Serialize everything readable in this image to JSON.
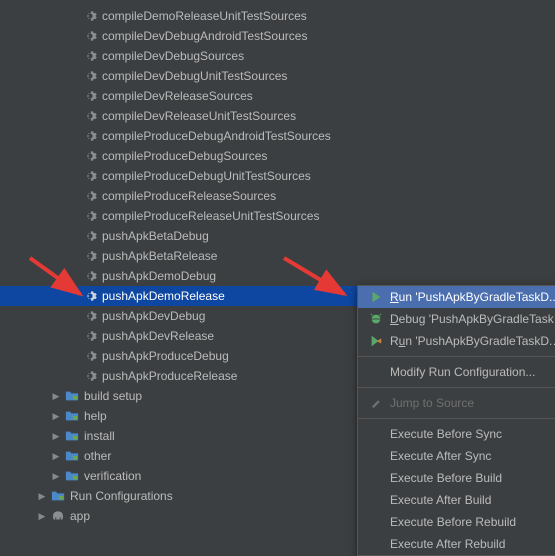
{
  "tree": {
    "tasks": [
      "compileDemoReleaseUnitTestSources",
      "compileDevDebugAndroidTestSources",
      "compileDevDebugSources",
      "compileDevDebugUnitTestSources",
      "compileDevReleaseSources",
      "compileDevReleaseUnitTestSources",
      "compileProduceDebugAndroidTestSources",
      "compileProduceDebugSources",
      "compileProduceDebugUnitTestSources",
      "compileProduceReleaseSources",
      "compileProduceReleaseUnitTestSources",
      "pushApkBetaDebug",
      "pushApkBetaRelease",
      "pushApkDemoDebug",
      "pushApkDemoRelease",
      "pushApkDevDebug",
      "pushApkDevRelease",
      "pushApkProduceDebug",
      "pushApkProduceRelease"
    ],
    "selected_task_index": 14,
    "folders": [
      "build setup",
      "help",
      "install",
      "other",
      "verification"
    ],
    "top_items": [
      "Run Configurations",
      "app"
    ]
  },
  "menu": {
    "items": [
      {
        "label": "Run 'PushApkByGradleTaskD...'",
        "icon": "run",
        "selected": true
      },
      {
        "label": "Debug 'PushApkByGradleTaskD...'",
        "icon": "debug"
      },
      {
        "label": "Run 'PushApkByGradleTaskD...' wit",
        "icon": "run-coverage"
      }
    ],
    "modify": "Modify Run Configuration...",
    "jump": "Jump to Source",
    "exec": [
      "Execute Before Sync",
      "Execute After Sync",
      "Execute Before Build",
      "Execute After Build",
      "Execute Before Rebuild",
      "Execute After Rebuild"
    ]
  }
}
